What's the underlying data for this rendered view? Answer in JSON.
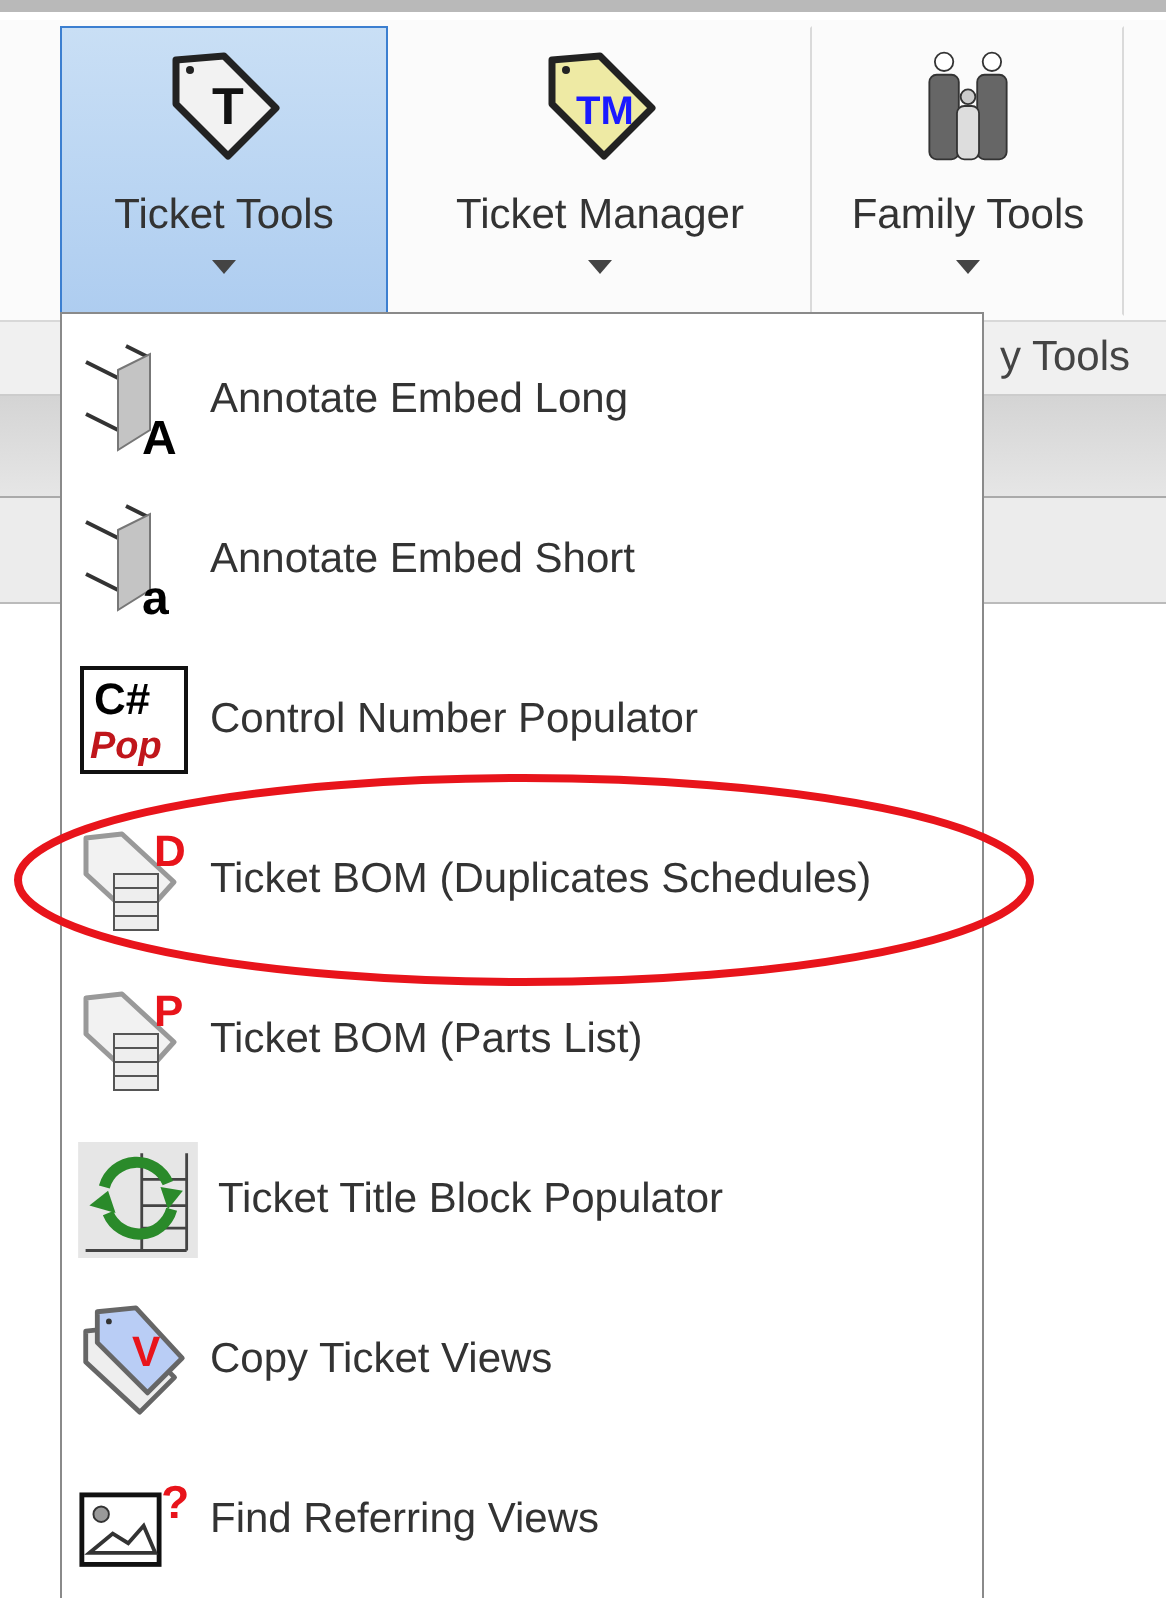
{
  "ribbon": {
    "buttons": [
      {
        "label": "Ticket Tools",
        "kind": "tag",
        "icon_text": "T",
        "selected": true
      },
      {
        "label": "Ticket Manager",
        "kind": "tag-yellow",
        "icon_text": "TM",
        "selected": false
      },
      {
        "label": "Family Tools",
        "kind": "family",
        "selected": false
      }
    ],
    "panel_label": "y Tools"
  },
  "menu": {
    "items": [
      {
        "label": "Annotate Embed Long",
        "kind": "annotate",
        "icon_text": "A",
        "circled": false
      },
      {
        "label": "Annotate Embed Short",
        "kind": "annotate",
        "icon_text": "a",
        "circled": false
      },
      {
        "label": "Control Number Populator",
        "kind": "code",
        "icon_text": "C#",
        "icon_subtext": "Pop",
        "circled": false
      },
      {
        "label": "Ticket BOM (Duplicates Schedules)",
        "kind": "bom",
        "icon_text": "D",
        "circled": true
      },
      {
        "label": "Ticket BOM (Parts List)",
        "kind": "bom",
        "icon_text": "P",
        "circled": false
      },
      {
        "label": "Ticket Title Block Populator",
        "kind": "refresh",
        "circled": false
      },
      {
        "label": "Copy Ticket Views",
        "kind": "copy",
        "icon_text": "V",
        "circled": false
      },
      {
        "label": "Find Referring Views",
        "kind": "find",
        "icon_text": "?",
        "circled": false
      }
    ]
  }
}
